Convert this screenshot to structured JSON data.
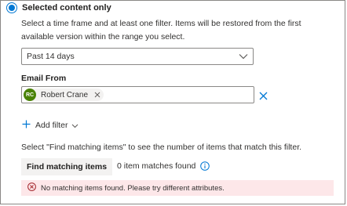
{
  "scope": {
    "selected_label": "Selected content only",
    "description": "Select a time frame and at least one filter. Items will be restored from the first available version within the range you select."
  },
  "time_range": {
    "value": "Past 14 days",
    "icon": "chevron-down-icon"
  },
  "email_from": {
    "label": "Email From",
    "chips": [
      {
        "initials": "RC",
        "name": "Robert Crane",
        "avatar_color": "#498205"
      }
    ]
  },
  "add_filter": {
    "label": "Add filter"
  },
  "matching": {
    "hint": "Select \"Find matching items\" to see the number of items that match this filter.",
    "button_label": "Find matching items",
    "result_text": "0 item matches found"
  },
  "error": {
    "message": "No matching items found. Please try different attributes.",
    "color": "#a4262c"
  },
  "colors": {
    "accent": "#0078d4",
    "error_background": "#fde7e9"
  }
}
